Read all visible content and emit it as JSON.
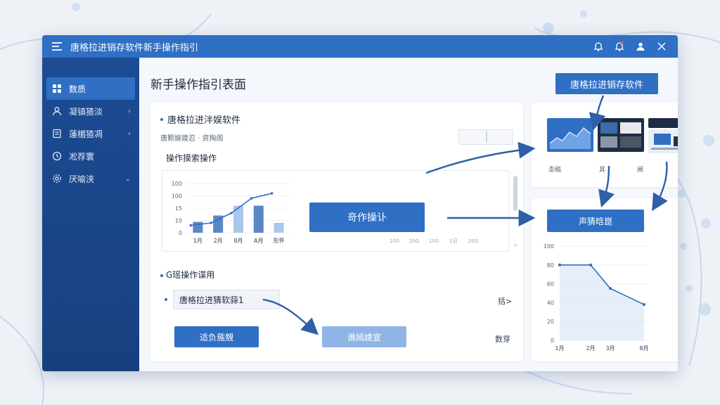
{
  "window": {
    "title": "唐格拉进销存软件新手操作指引",
    "icons": [
      "menu-icon",
      "bell-icon",
      "notification-bell-icon",
      "user-icon",
      "close-icon"
    ]
  },
  "sidebar": {
    "items": [
      {
        "label": "数质",
        "icon": "grid-icon",
        "active": true,
        "has_chevron": false
      },
      {
        "label": "凝镇猹淡",
        "icon": "user-icon",
        "active": false,
        "has_chevron": true
      },
      {
        "label": "蓮楣猹凋",
        "icon": "document-icon",
        "active": false,
        "has_chevron": true
      },
      {
        "label": "凇荐寰",
        "icon": "clock-icon",
        "active": false,
        "has_chevron": false
      },
      {
        "label": "厌喻浃",
        "icon": "settings-icon",
        "active": false,
        "has_chevron": true
      }
    ]
  },
  "main": {
    "page_title": "新手操作指引表面",
    "top_button": "唐格拉进销存软件",
    "section1": {
      "title": "唐格拉进泮娱软件",
      "subtitle": "唐颗娱鑁忍 · 资掏阁",
      "subsection": "操作摸索操作"
    },
    "center_button": "竒作操讣",
    "section2": {
      "title": "G瑶操作谍用",
      "input_value": "唐格拉进猜软蒜1",
      "side_link": "括>",
      "primary_button": "适负葹覫",
      "secondary_button": "谯嫣娩宣",
      "bottom_link": "数芽"
    },
    "scroll_chevron": "⌄"
  },
  "thumbs": {
    "labels": [
      "澎稿",
      "其",
      "阙"
    ]
  },
  "line_panel": {
    "button": "声猜晗崑"
  },
  "chart_data": [
    {
      "type": "bar",
      "categories": [
        "1月",
        "2月",
        "8月",
        "A月",
        "形怀"
      ],
      "values": [
        22,
        35,
        55,
        55,
        20
      ],
      "line_overlay": [
        15,
        20,
        40,
        70,
        80
      ],
      "line_x_categories_span": 4,
      "ytick_labels": [
        "100",
        "100",
        "15",
        "10",
        "0"
      ],
      "ylim": [
        0,
        100
      ],
      "extra_x_labels": [
        "10G",
        "20G",
        "10G",
        "1日",
        "20G"
      ],
      "colors": {
        "bars_dark": "#5b87c4",
        "bars_light": "#a9c7ec",
        "line": "#2f6fc4"
      }
    },
    {
      "type": "line",
      "categories": [
        "1月",
        "2月",
        "3月",
        "8月"
      ],
      "values": [
        80,
        80,
        55,
        38
      ],
      "ytick_labels": [
        "100",
        "80",
        "60",
        "40",
        "20",
        "0"
      ],
      "ylim": [
        0,
        100
      ],
      "colors": {
        "line": "#2f6fc4",
        "fill": "#dbe8f7"
      }
    }
  ]
}
